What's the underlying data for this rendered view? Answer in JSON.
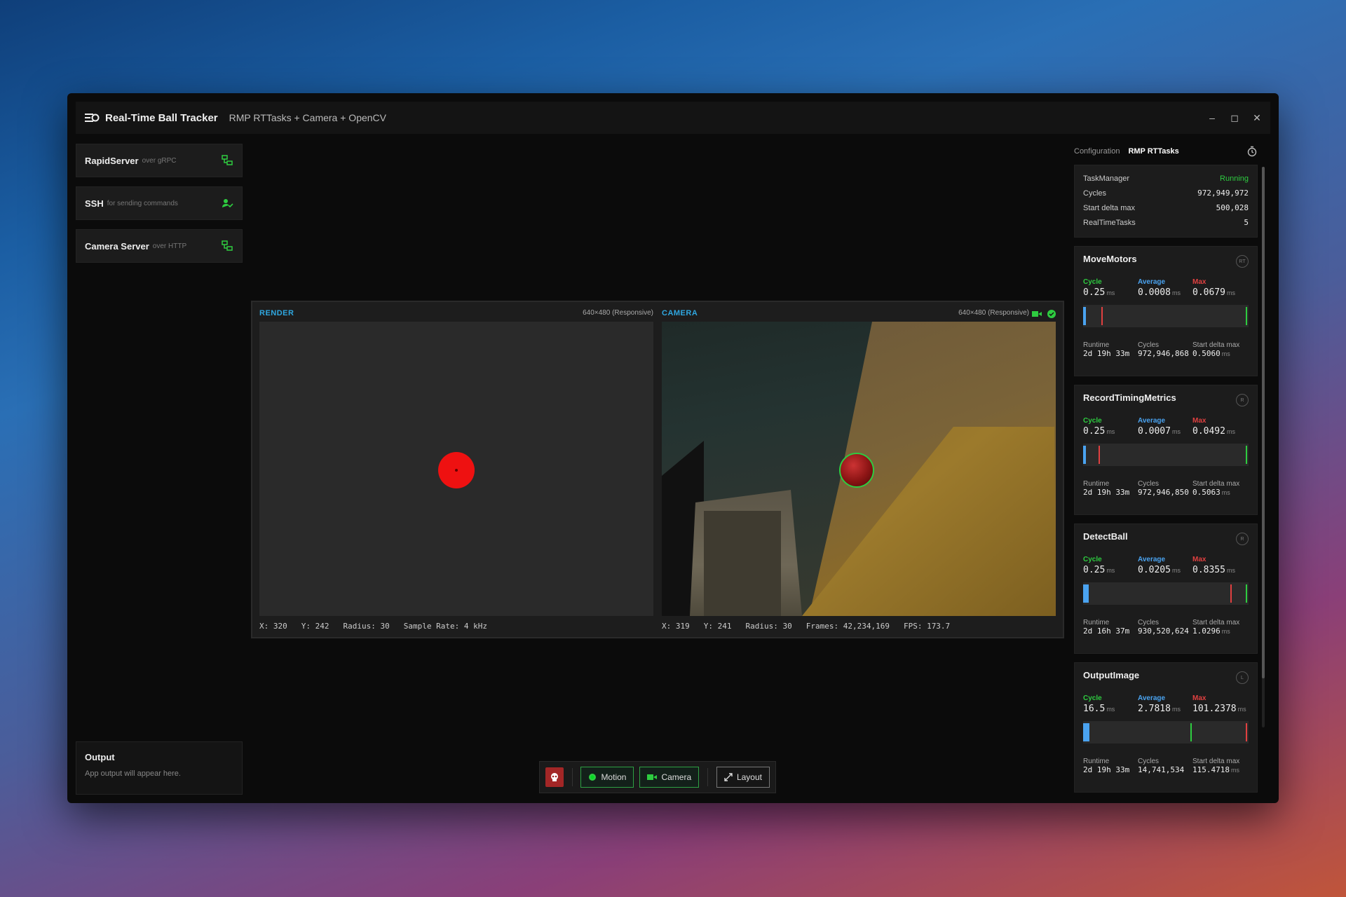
{
  "window": {
    "title": "Real-Time Ball Tracker",
    "subtitle": "RMP RTTasks + Camera + OpenCV",
    "minimize": "–",
    "maximize": "◻",
    "close": "✕"
  },
  "servers": [
    {
      "name": "RapidServer",
      "desc": "over gRPC",
      "icon": "server-connected-icon"
    },
    {
      "name": "SSH",
      "desc": "for sending commands",
      "icon": "user-check-icon"
    },
    {
      "name": "Camera Server",
      "desc": "over HTTP",
      "icon": "server-connected-icon"
    }
  ],
  "output": {
    "title": "Output",
    "text": "App output will appear here."
  },
  "render": {
    "label": "RENDER",
    "resolution": "640×480 (Responsive)",
    "stats": [
      "X: 320",
      "Y: 242",
      "Radius: 30",
      "Sample Rate: 4 kHz"
    ]
  },
  "camera": {
    "label": "CAMERA",
    "resolution": "640×480 (Responsive)",
    "stats": [
      "X: 319",
      "Y: 241",
      "Radius: 30",
      "Frames: 42,234,169",
      "FPS: 173.7"
    ]
  },
  "toolbar": {
    "motion": "Motion",
    "camera": "Camera",
    "layout": "Layout"
  },
  "rpanel": {
    "tabs": [
      "Configuration",
      "RMP RTTasks"
    ],
    "task_manager": {
      "title": "TaskManager",
      "status": "Running",
      "rows": [
        {
          "k": "Cycles",
          "v": "972,949,972"
        },
        {
          "k": "Start delta max",
          "v": "500,028"
        },
        {
          "k": "RealTimeTasks",
          "v": "5"
        }
      ]
    },
    "labels": {
      "cycle": "Cycle",
      "average": "Average",
      "max": "Max",
      "runtime": "Runtime",
      "cycles": "Cycles",
      "start_delta_max": "Start delta max",
      "unit": "ms"
    },
    "tasks": [
      {
        "name": "MoveMotors",
        "badge": "RT",
        "cycle": "0.25",
        "average": "0.0008",
        "max": "0.0679",
        "runtime": "2d 19h 33m",
        "cycles": "972,946,868",
        "start_delta": "0.5060",
        "avg_frac": 0.003,
        "max_frac": 0.07
      },
      {
        "name": "RecordTimingMetrics",
        "badge": "R",
        "cycle": "0.25",
        "average": "0.0007",
        "max": "0.0492",
        "runtime": "2d 19h 33m",
        "cycles": "972,946,850",
        "start_delta": "0.5063",
        "avg_frac": 0.003,
        "max_frac": 0.05
      },
      {
        "name": "DetectBall",
        "badge": "R",
        "cycle": "0.25",
        "average": "0.0205",
        "max": "0.8355",
        "runtime": "2d 16h 37m",
        "cycles": "930,520,624",
        "start_delta": "1.0296",
        "avg_frac": 0.02,
        "max_frac": 0.86
      },
      {
        "name": "OutputImage",
        "badge": "L",
        "cycle": "16.5",
        "average": "2.7818",
        "max": "101.2378",
        "runtime": "2d 19h 33m",
        "cycles": "14,741,534",
        "start_delta": "115.4718",
        "avg_frac": 0.027,
        "max_frac": 1.0,
        "cycle_frac": 0.66
      }
    ]
  }
}
